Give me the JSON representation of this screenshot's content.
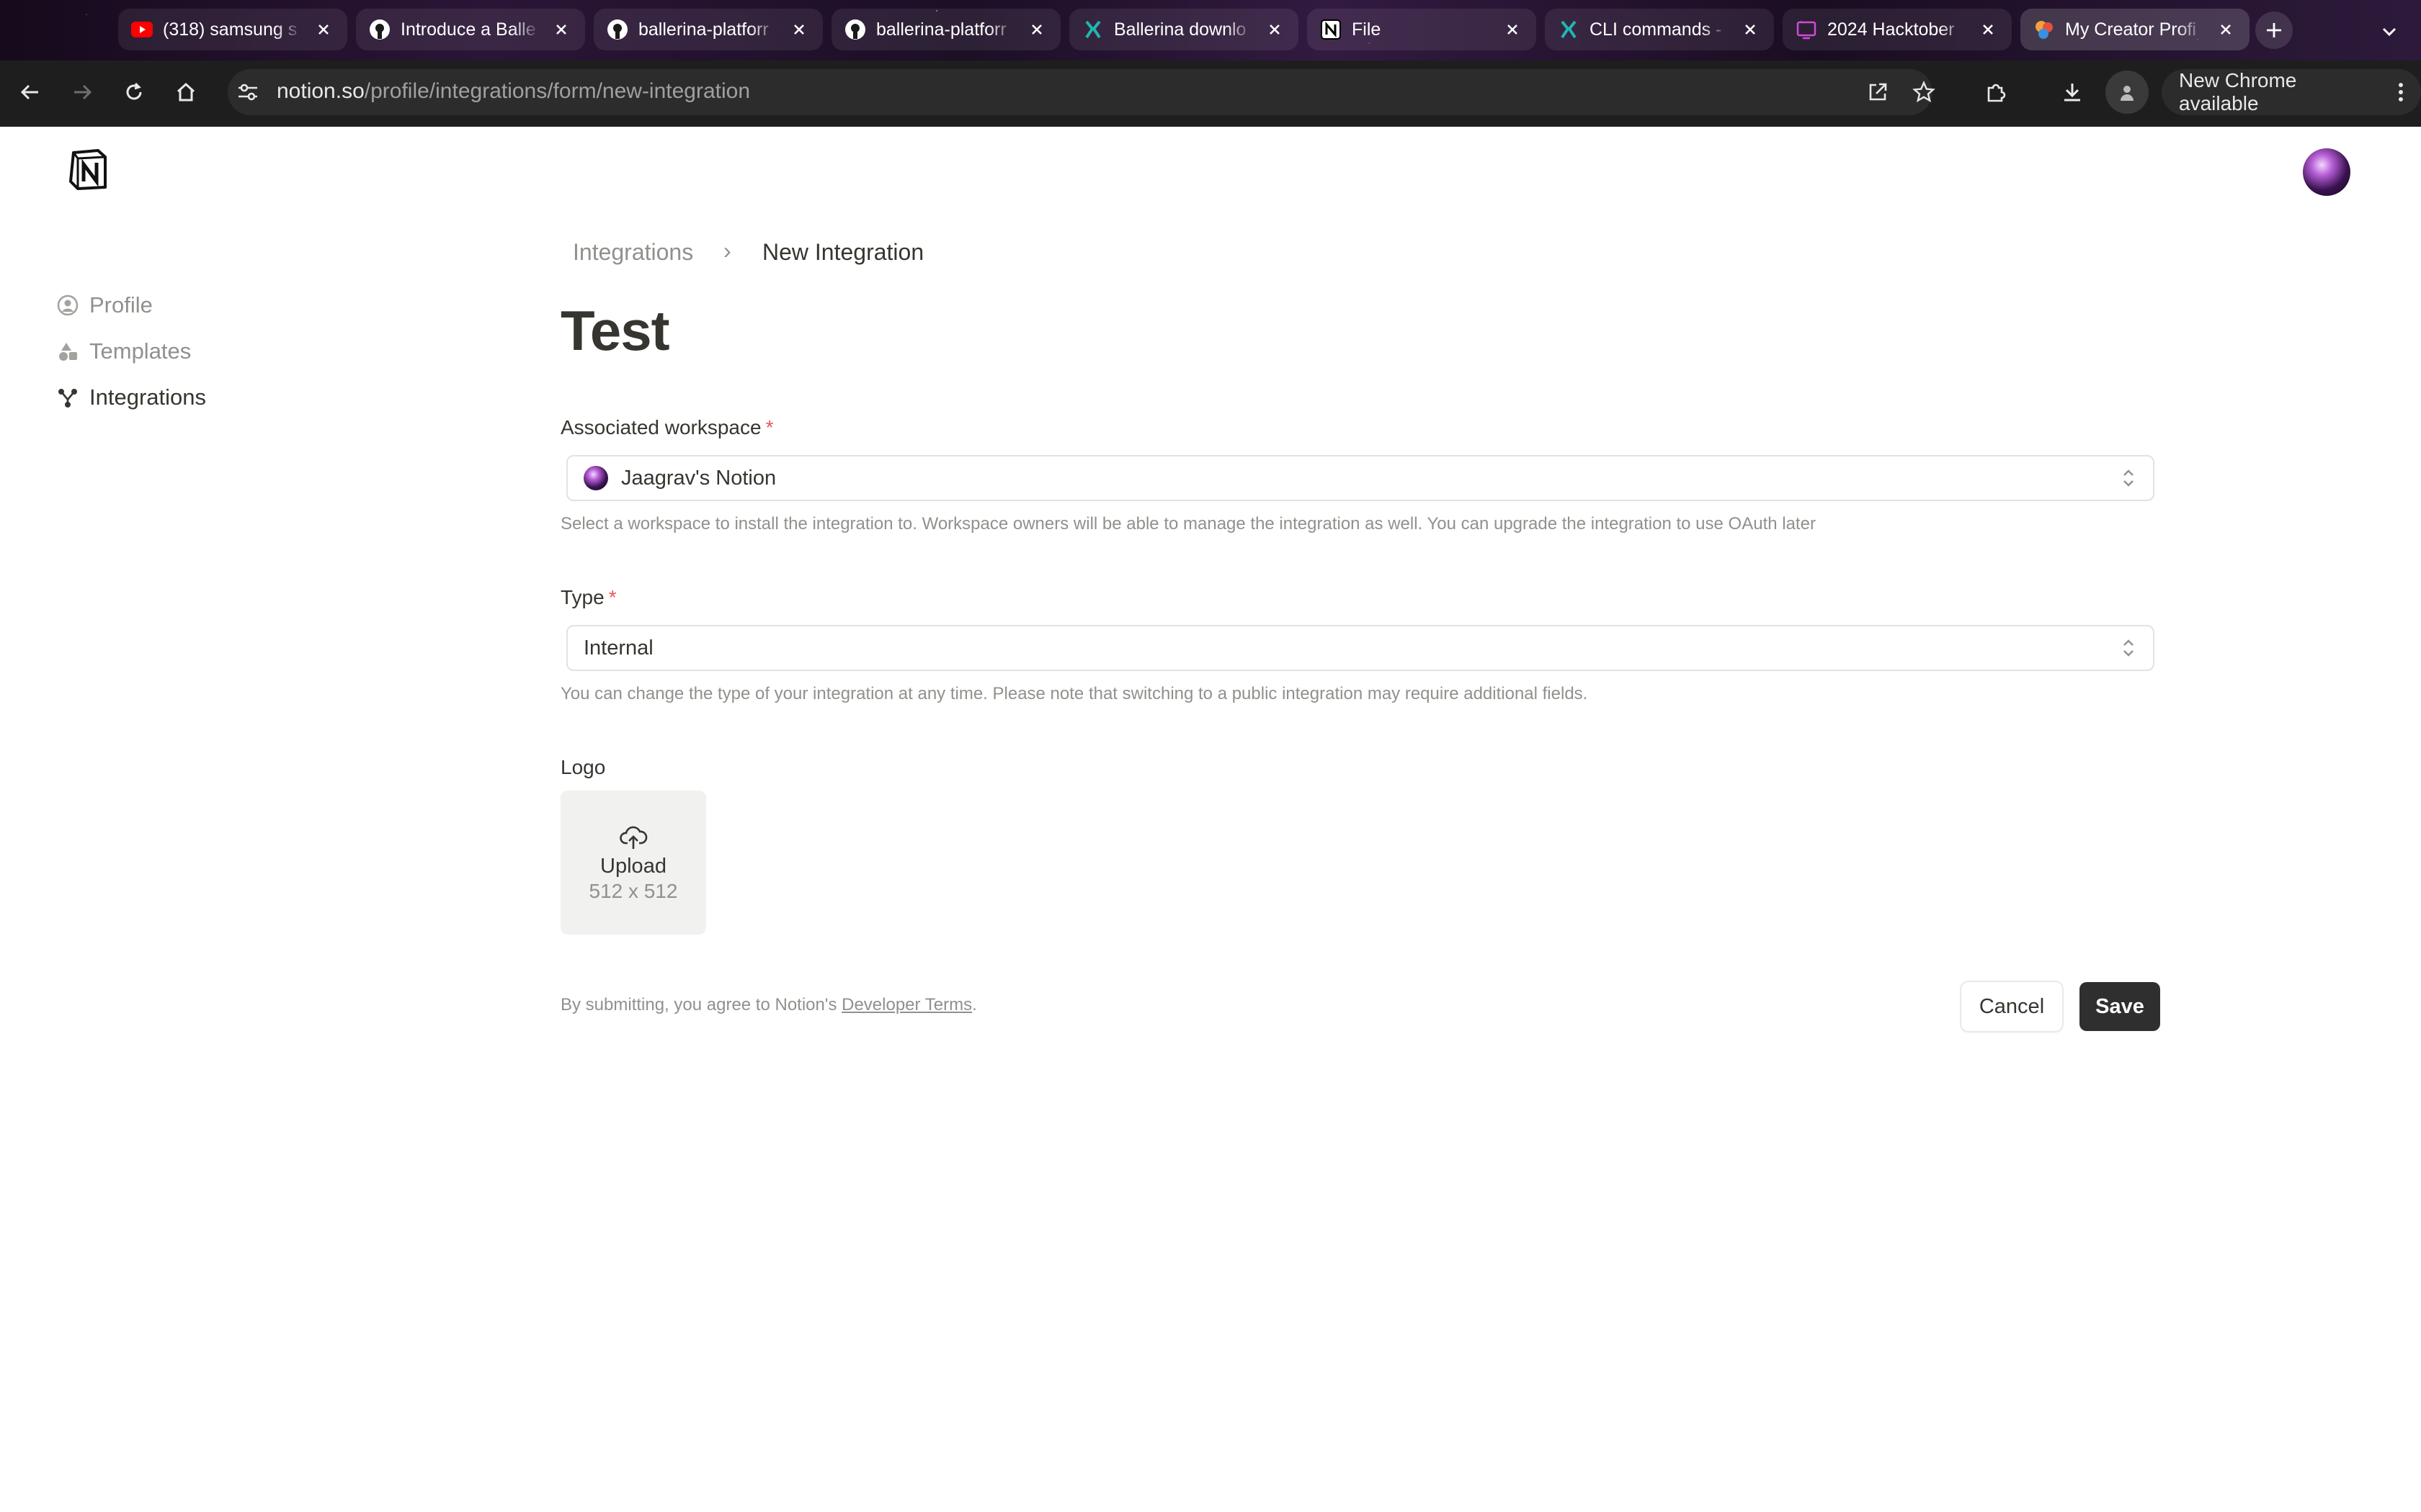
{
  "browser": {
    "tabs": [
      {
        "title": "(318) samsung s",
        "favicon": "youtube-icon",
        "active": false
      },
      {
        "title": "Introduce a Balle",
        "favicon": "github-icon",
        "active": false
      },
      {
        "title": "ballerina-platforr",
        "favicon": "github-icon",
        "active": false
      },
      {
        "title": "ballerina-platforr",
        "favicon": "github-icon",
        "active": false
      },
      {
        "title": "Ballerina downlo",
        "favicon": "ballerina-icon",
        "active": false
      },
      {
        "title": "File",
        "favicon": "notion-icon",
        "active": false
      },
      {
        "title": "CLI commands -",
        "favicon": "ballerina-icon",
        "active": false
      },
      {
        "title": "2024 Hacktober",
        "favicon": "hacktoberfest-icon",
        "active": false
      },
      {
        "title": "My Creator Profi",
        "favicon": "notion-creator-icon",
        "active": true
      }
    ],
    "url_host": "notion.so",
    "url_path": "/profile/integrations/form/new-integration",
    "update_label": "New Chrome available",
    "colors": {
      "accent": "#2f2f2f",
      "required": "#eb5757"
    }
  },
  "sidebar": {
    "items": [
      {
        "label": "Profile",
        "icon": "person-circle-icon"
      },
      {
        "label": "Templates",
        "icon": "shapes-icon"
      },
      {
        "label": "Integrations",
        "icon": "integrations-icon"
      }
    ]
  },
  "breadcrumb": {
    "parent": "Integrations",
    "separator": "›",
    "current": "New Integration"
  },
  "form": {
    "title": "Test",
    "workspace": {
      "label": "Associated workspace",
      "required_mark": "*",
      "value": "Jaagrav's Notion",
      "helper": "Select a workspace to install the integration to. Workspace owners will be able to manage the integration as well. You can upgrade the integration to use OAuth later"
    },
    "type": {
      "label": "Type",
      "required_mark": "*",
      "value": "Internal",
      "helper": "You can change the type of your integration at any time. Please note that switching to a public integration may require additional fields."
    },
    "logo": {
      "label": "Logo",
      "upload_label": "Upload",
      "size_hint": "512 x 512"
    },
    "terms_prefix": "By submitting, you agree to Notion's ",
    "terms_link": "Developer Terms",
    "terms_suffix": ".",
    "cancel_label": "Cancel",
    "save_label": "Save"
  }
}
